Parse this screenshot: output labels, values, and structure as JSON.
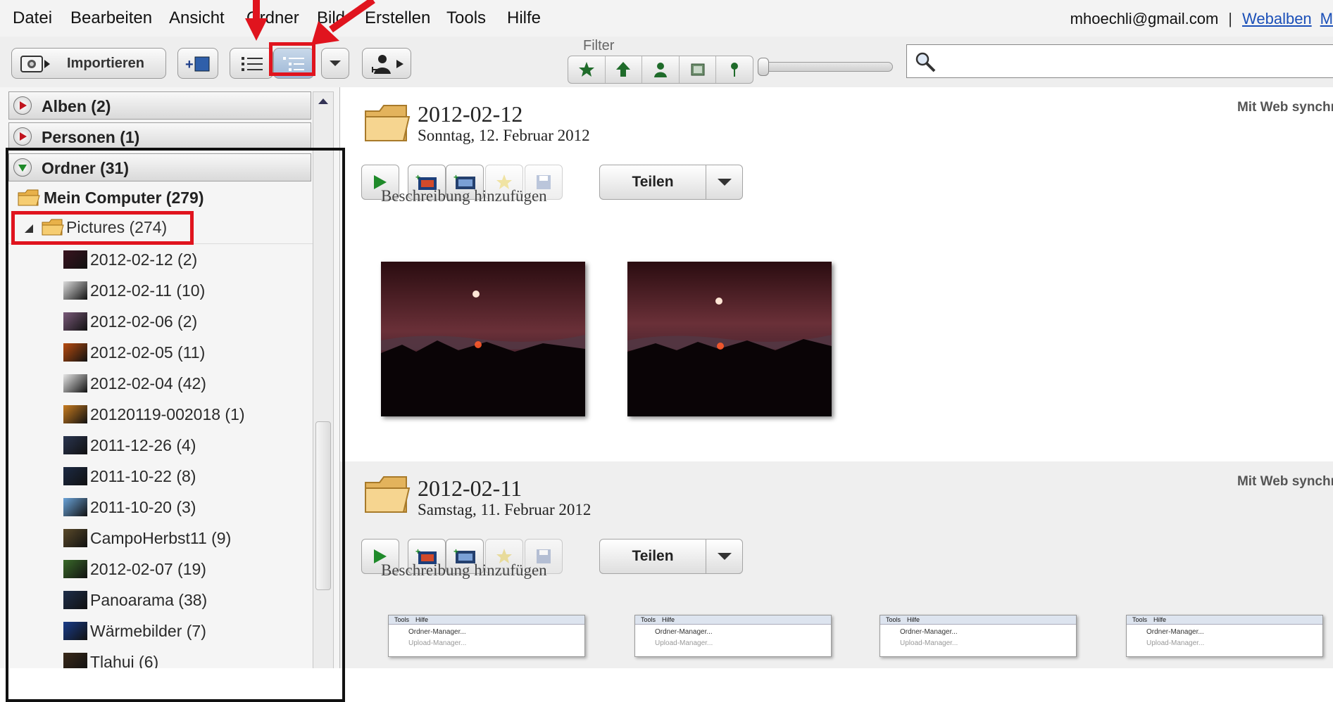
{
  "menu": [
    "Datei",
    "Bearbeiten",
    "Ansicht",
    "Ordner",
    "Bild",
    "Erstellen",
    "Tools",
    "Hilfe"
  ],
  "account": {
    "email": "mhoechli@gmail.com",
    "separator": "|",
    "webalben": "Webalben",
    "cut_link": "M"
  },
  "toolbar": {
    "import_label": "Importieren",
    "filter_label": "Filter",
    "filters": [
      "star-icon",
      "upload-arrow-icon",
      "person-icon",
      "film-icon",
      "pin-icon"
    ],
    "search_placeholder": ""
  },
  "sidebar": {
    "sections": [
      {
        "label": "Alben (2)",
        "state": "collapsed"
      },
      {
        "label": "Personen (1)",
        "state": "collapsed"
      },
      {
        "label": "Ordner (31)",
        "state": "expanded"
      }
    ],
    "root": "Mein Computer (279)",
    "pictures": "Pictures (274)",
    "folders": [
      {
        "name": "2012-02-12 (2)",
        "thumb": "#3a1420"
      },
      {
        "name": "2012-02-11 (10)",
        "thumb": "#dcdcdc"
      },
      {
        "name": "2012-02-06 (2)",
        "thumb": "#7a5a7a"
      },
      {
        "name": "2012-02-05 (11)",
        "thumb": "#b84c10"
      },
      {
        "name": "2012-02-04 (42)",
        "thumb": "#e6e6e6"
      },
      {
        "name": "20120119-002018 (1)",
        "thumb": "#c87c20"
      },
      {
        "name": "2011-12-26 (4)",
        "thumb": "#2a3550"
      },
      {
        "name": "2011-10-22 (8)",
        "thumb": "#1c2a44"
      },
      {
        "name": "2011-10-20 (3)",
        "thumb": "#6aa3d8"
      },
      {
        "name": "CampoHerbst11 (9)",
        "thumb": "#5a4a2a"
      },
      {
        "name": "2012-02-07 (19)",
        "thumb": "#3a6a2a"
      },
      {
        "name": "Panoarama (38)",
        "thumb": "#1e2e4a"
      },
      {
        "name": "Wärmebilder (7)",
        "thumb": "#1a3d8a"
      },
      {
        "name": "Tlahui (6)",
        "thumb": "#3a2a1a"
      }
    ]
  },
  "groups": [
    {
      "title": "2012-02-12",
      "subtitle": "Sonntag, 12. Februar 2012",
      "sync": "Mit Web synchr",
      "share": "Teilen",
      "description": "Beschreibung hinzufügen"
    },
    {
      "title": "2012-02-11",
      "subtitle": "Samstag, 11. Februar 2012",
      "sync": "Mit Web synchr",
      "share": "Teilen",
      "description": "Beschreibung hinzufügen"
    }
  ],
  "screenshot_thumb": {
    "menu1": "Tools",
    "menu2": "Hilfe",
    "item1": "Ordner-Manager...",
    "item2": "Upload-Manager..."
  },
  "colors": {
    "annotation_red": "#e0141e",
    "annotation_black": "#111111",
    "link": "#1a4fb8"
  }
}
